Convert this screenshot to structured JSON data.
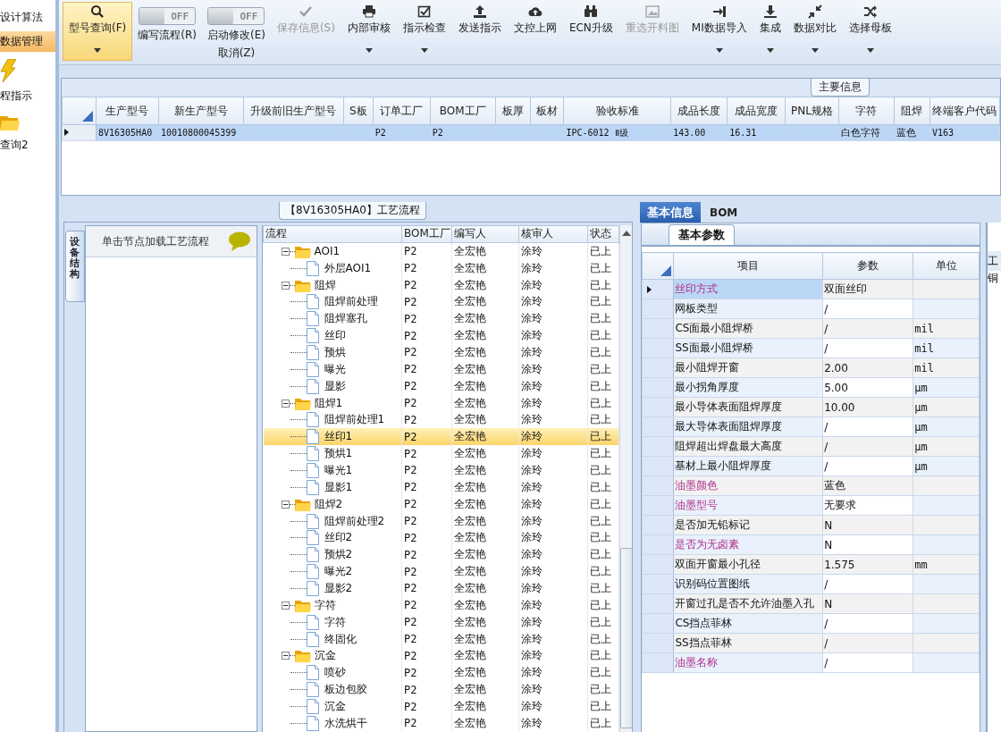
{
  "sidebar": {
    "items": [
      {
        "kind": "text",
        "label": "设计算法",
        "selected": false
      },
      {
        "kind": "text",
        "label": "数据管理",
        "selected": true
      },
      {
        "kind": "icon",
        "label": "程指示",
        "selected": false
      },
      {
        "kind": "icon",
        "label": "查询2",
        "selected": false
      }
    ]
  },
  "toolbar": {
    "buttons": [
      {
        "kind": "button",
        "label": "型号查询(F)",
        "selected": true,
        "disabled": false,
        "dropdown": true
      },
      {
        "kind": "toggle",
        "switch_text": "OFF",
        "on": false,
        "label": "编写流程(R)"
      },
      {
        "kind": "toggle",
        "switch_text": "OFF",
        "on": false,
        "label": "启动修改(E)",
        "sublabel": "取消(Z)"
      },
      {
        "kind": "button",
        "label": "保存信息(S)",
        "selected": false,
        "disabled": true,
        "dropdown": false
      },
      {
        "kind": "button",
        "label": "内部审核",
        "selected": false,
        "disabled": false,
        "dropdown": true
      },
      {
        "kind": "button",
        "label": "指示检查",
        "selected": false,
        "disabled": false,
        "dropdown": true
      },
      {
        "kind": "button",
        "label": "发送指示",
        "selected": false,
        "disabled": false,
        "dropdown": false
      },
      {
        "kind": "button",
        "label": "文控上网",
        "selected": false,
        "disabled": false,
        "dropdown": false
      },
      {
        "kind": "button",
        "label": "ECN升级",
        "selected": false,
        "disabled": false,
        "dropdown": false
      },
      {
        "kind": "button",
        "label": "重选开料图",
        "selected": false,
        "disabled": true,
        "dropdown": false
      },
      {
        "kind": "button",
        "label": "MI数据导入",
        "selected": false,
        "disabled": false,
        "dropdown": true
      },
      {
        "kind": "button",
        "label": "集成",
        "selected": false,
        "disabled": false,
        "dropdown": true
      },
      {
        "kind": "button",
        "label": "数据对比",
        "selected": false,
        "disabled": false,
        "dropdown": true
      },
      {
        "kind": "button",
        "label": "选择母板",
        "selected": false,
        "disabled": false,
        "dropdown": true
      }
    ]
  },
  "main_info": {
    "title": "主要信息",
    "columns": [
      "生产型号",
      "新生产型号",
      "升级前旧生产型号",
      "S板",
      "订单工厂",
      "BOM工厂",
      "板厚",
      "板材",
      "验收标准",
      "成品长度",
      "成品宽度",
      "PNL规格",
      "字符",
      "阻焊",
      "终端客户代码"
    ],
    "rows": [
      {
        "selected": true,
        "cells": [
          "8V16305HA0",
          "10010800045399",
          null,
          null,
          "P2",
          "P2",
          null,
          null,
          "IPC-6012 Ⅱ级",
          "143.00",
          "16.31",
          null,
          "白色字符",
          "蓝色",
          "V163"
        ]
      }
    ]
  },
  "process": {
    "title": "【8V16305HA0】工艺流程",
    "side_tab": "设备结构",
    "hint": "单击节点加载工艺流程",
    "columns": [
      "流程",
      "BOM工厂",
      "编写人",
      "核审人",
      "状态"
    ],
    "tree": [
      {
        "name": "AOI1",
        "bom": "P2",
        "writer": "全宏艳",
        "reviewer": "涂玲",
        "status": "已上",
        "selected": false,
        "expanded": true,
        "children": [
          {
            "name": "外层AOI1",
            "bom": "P2",
            "writer": "全宏艳",
            "reviewer": "涂玲",
            "status": "已上",
            "selected": false
          }
        ]
      },
      {
        "name": "阻焊",
        "bom": "P2",
        "writer": "全宏艳",
        "reviewer": "涂玲",
        "status": "已上",
        "selected": false,
        "expanded": true,
        "children": [
          {
            "name": "阻焊前处理",
            "bom": "P2",
            "writer": "全宏艳",
            "reviewer": "涂玲",
            "status": "已上",
            "selected": false
          },
          {
            "name": "阻焊塞孔",
            "bom": "P2",
            "writer": "全宏艳",
            "reviewer": "涂玲",
            "status": "已上",
            "selected": false
          },
          {
            "name": "丝印",
            "bom": "P2",
            "writer": "全宏艳",
            "reviewer": "涂玲",
            "status": "已上",
            "selected": false
          },
          {
            "name": "预烘",
            "bom": "P2",
            "writer": "全宏艳",
            "reviewer": "涂玲",
            "status": "已上",
            "selected": false
          },
          {
            "name": "曝光",
            "bom": "P2",
            "writer": "全宏艳",
            "reviewer": "涂玲",
            "status": "已上",
            "selected": false
          },
          {
            "name": "显影",
            "bom": "P2",
            "writer": "全宏艳",
            "reviewer": "涂玲",
            "status": "已上",
            "selected": false
          }
        ]
      },
      {
        "name": "阻焊1",
        "bom": "P2",
        "writer": "全宏艳",
        "reviewer": "涂玲",
        "status": "已上",
        "selected": false,
        "expanded": true,
        "children": [
          {
            "name": "阻焊前处理1",
            "bom": "P2",
            "writer": "全宏艳",
            "reviewer": "涂玲",
            "status": "已上",
            "selected": false
          },
          {
            "name": "丝印1",
            "bom": "P2",
            "writer": "全宏艳",
            "reviewer": "涂玲",
            "status": "已上",
            "selected": true
          },
          {
            "name": "预烘1",
            "bom": "P2",
            "writer": "全宏艳",
            "reviewer": "涂玲",
            "status": "已上",
            "selected": false
          },
          {
            "name": "曝光1",
            "bom": "P2",
            "writer": "全宏艳",
            "reviewer": "涂玲",
            "status": "已上",
            "selected": false
          },
          {
            "name": "显影1",
            "bom": "P2",
            "writer": "全宏艳",
            "reviewer": "涂玲",
            "status": "已上",
            "selected": false
          }
        ]
      },
      {
        "name": "阻焊2",
        "bom": "P2",
        "writer": "全宏艳",
        "reviewer": "涂玲",
        "status": "已上",
        "selected": false,
        "expanded": true,
        "children": [
          {
            "name": "阻焊前处理2",
            "bom": "P2",
            "writer": "全宏艳",
            "reviewer": "涂玲",
            "status": "已上",
            "selected": false
          },
          {
            "name": "丝印2",
            "bom": "P2",
            "writer": "全宏艳",
            "reviewer": "涂玲",
            "status": "已上",
            "selected": false
          },
          {
            "name": "预烘2",
            "bom": "P2",
            "writer": "全宏艳",
            "reviewer": "涂玲",
            "status": "已上",
            "selected": false
          },
          {
            "name": "曝光2",
            "bom": "P2",
            "writer": "全宏艳",
            "reviewer": "涂玲",
            "status": "已上",
            "selected": false
          },
          {
            "name": "显影2",
            "bom": "P2",
            "writer": "全宏艳",
            "reviewer": "涂玲",
            "status": "已上",
            "selected": false
          }
        ]
      },
      {
        "name": "字符",
        "bom": "P2",
        "writer": "全宏艳",
        "reviewer": "涂玲",
        "status": "已上",
        "selected": false,
        "expanded": true,
        "children": [
          {
            "name": "字符",
            "bom": "P2",
            "writer": "全宏艳",
            "reviewer": "涂玲",
            "status": "已上",
            "selected": false
          },
          {
            "name": "终固化",
            "bom": "P2",
            "writer": "全宏艳",
            "reviewer": "涂玲",
            "status": "已上",
            "selected": false
          }
        ]
      },
      {
        "name": "沉金",
        "bom": "P2",
        "writer": "全宏艳",
        "reviewer": "涂玲",
        "status": "已上",
        "selected": false,
        "expanded": true,
        "children": [
          {
            "name": "喷砂",
            "bom": "P2",
            "writer": "全宏艳",
            "reviewer": "涂玲",
            "status": "已上",
            "selected": false
          },
          {
            "name": "板边包胶",
            "bom": "P2",
            "writer": "全宏艳",
            "reviewer": "涂玲",
            "status": "已上",
            "selected": false
          },
          {
            "name": "沉金",
            "bom": "P2",
            "writer": "全宏艳",
            "reviewer": "涂玲",
            "status": "已上",
            "selected": false
          },
          {
            "name": "水洗烘干",
            "bom": "P2",
            "writer": "全宏艳",
            "reviewer": "涂玲",
            "status": "已上",
            "selected": false
          }
        ]
      }
    ]
  },
  "details": {
    "tabs": [
      {
        "label": "基本信息",
        "selected": true
      },
      {
        "label": "BOM",
        "selected": false
      }
    ],
    "sub_tab": "基本参数",
    "columns": [
      "项目",
      "参数",
      "单位"
    ],
    "rows": [
      {
        "item": "丝印方式",
        "value": "双面丝印",
        "flagged": true,
        "selected": true
      },
      {
        "item": "网板类型",
        "value": "/",
        "flagged": false,
        "selected": false
      },
      {
        "item": "CS面最小阻焊桥",
        "value": "/",
        "unit": "mil",
        "flagged": false,
        "selected": false
      },
      {
        "item": "SS面最小阻焊桥",
        "value": "/",
        "unit": "mil",
        "flagged": false,
        "selected": false
      },
      {
        "item": "最小阻焊开窗",
        "value": "2.00",
        "unit": "mil",
        "flagged": false,
        "selected": false
      },
      {
        "item": "最小拐角厚度",
        "value": "5.00",
        "unit": "μm",
        "flagged": false,
        "selected": false
      },
      {
        "item": "最小导体表面阻焊厚度",
        "value": "10.00",
        "unit": "μm",
        "flagged": false,
        "selected": false
      },
      {
        "item": "最大导体表面阻焊厚度",
        "value": "/",
        "unit": "μm",
        "flagged": false,
        "selected": false
      },
      {
        "item": "阻焊超出焊盘最大高度",
        "value": "/",
        "unit": "μm",
        "flagged": false,
        "selected": false
      },
      {
        "item": "基材上最小阻焊厚度",
        "value": "/",
        "unit": "μm",
        "flagged": false,
        "selected": false
      },
      {
        "item": "油墨颜色",
        "value": "蓝色",
        "flagged": true,
        "selected": false
      },
      {
        "item": "油墨型号",
        "value": "无要求",
        "flagged": true,
        "selected": false
      },
      {
        "item": "是否加无铅标记",
        "value": "N",
        "flagged": false,
        "selected": false
      },
      {
        "item": "是否为无卤素",
        "value": "N",
        "flagged": true,
        "selected": false
      },
      {
        "item": "双面开窗最小孔径",
        "value": "1.575",
        "unit": "mm",
        "flagged": false,
        "selected": false
      },
      {
        "item": "识别码位置图纸",
        "value": "/",
        "flagged": false,
        "selected": false
      },
      {
        "item": "开窗过孔是否不允许油墨入孔",
        "value": "N",
        "flagged": false,
        "selected": false
      },
      {
        "item": "CS挡点菲林",
        "value": "/",
        "flagged": false,
        "selected": false
      },
      {
        "item": "SS挡点菲林",
        "value": "/",
        "flagged": false,
        "selected": false
      },
      {
        "item": "油墨名称",
        "value": "/",
        "flagged": true,
        "selected": false
      }
    ]
  },
  "side_panel": {
    "header": "工",
    "cell": "铜"
  }
}
